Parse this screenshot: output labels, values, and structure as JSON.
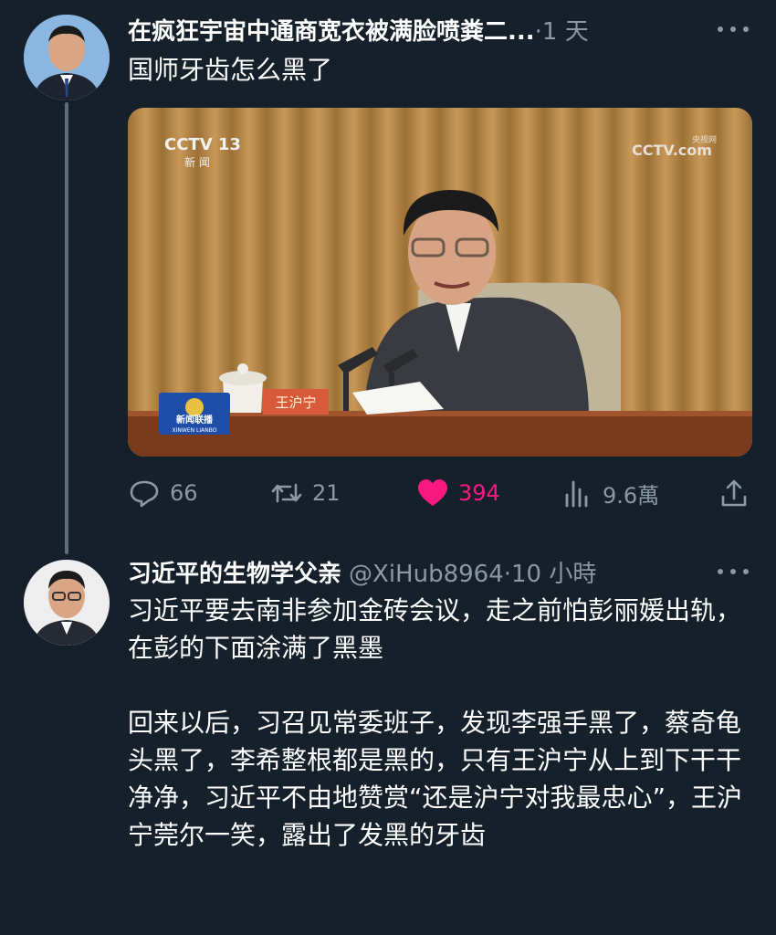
{
  "tweet1": {
    "author": "在疯狂宇宙中通商宽衣被满脸喷粪二...",
    "time": "·1 天",
    "text": "国师牙齿怎么黑了",
    "media": {
      "channel_logo": "CCTV 13",
      "channel_sub": "新 闻",
      "watermark": "CCTV.com",
      "watermark_sub": "央视网",
      "nameplate": "王沪宁",
      "show_logo": "新闻联播",
      "show_logo_sub": "XINWEN LIANBO"
    },
    "actions": {
      "replies": "66",
      "retweets": "21",
      "likes": "394",
      "views": "9.6萬"
    }
  },
  "tweet2": {
    "author": "习近平的生物学父亲",
    "handle_time": "@XiHub8964·10 小時",
    "paragraphs": [
      "习近平要去南非参加金砖会议，走之前怕彭丽媛出轨，在彭的下面涂满了黑墨",
      "回来以后，习召见常委班子，发现李强手黑了，蔡奇龟头黑了，李希整根都是黑的，只有王沪宁从上到下干干净净，习近平不由地赞赏“还是沪宁对我最忠心”，王沪宁莞尔一笑，露出了发黑的牙齿"
    ]
  },
  "colors": {
    "background": "#15202b",
    "muted": "#8b98a5",
    "like": "#f91880"
  },
  "icons": [
    "more-icon",
    "reply-icon",
    "retweet-icon",
    "heart-icon",
    "views-icon",
    "share-icon"
  ]
}
